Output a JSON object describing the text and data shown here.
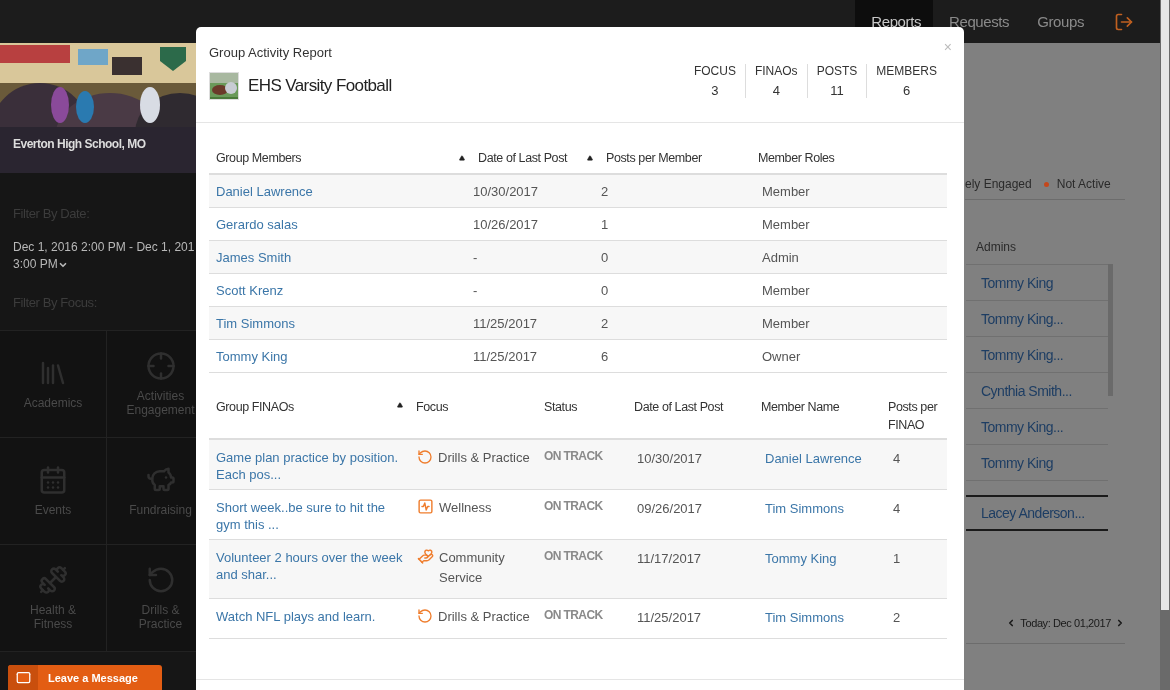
{
  "nav": {
    "items": [
      {
        "label": "Reports",
        "selected": true
      },
      {
        "label": "Requests",
        "selected": false
      },
      {
        "label": "Groups",
        "selected": false
      }
    ]
  },
  "sidebar": {
    "school": "Everton High School, MO",
    "date_filter_label": "Filter By Date:",
    "date_range": [
      "Dec 1, 2016 2:00 PM - Dec 1, 201",
      "3:00 PM"
    ],
    "focus_filter_label": "Filter By Focus:",
    "focus_tiles": [
      {
        "label": "Academics"
      },
      {
        "label": "Activities Engagement"
      },
      {
        "label": "Events"
      },
      {
        "label": "Fundraising"
      },
      {
        "label": "Health & Fitness"
      },
      {
        "label": "Drills & Practice"
      }
    ],
    "leave_message": "Leave a Message"
  },
  "main": {
    "legend": [
      {
        "label": "ely Engaged"
      },
      {
        "label": "Not Active",
        "color": "#c4471c"
      }
    ],
    "admins_header": "Admins",
    "admins": [
      "Tommy King",
      "Tommy King...",
      "Tommy King...",
      "Cynthia Smith...",
      "Tommy King...",
      "Tommy King"
    ],
    "highlighted_admin": "Lacey Anderson...",
    "date_nav": "Today: Dec 01,2017"
  },
  "modal": {
    "title": "Group Activity Report",
    "close": "×",
    "group_name": "EHS Varsity Football",
    "stats": [
      {
        "label": "FOCUS",
        "value": "3"
      },
      {
        "label": "FINAOs",
        "value": "4"
      },
      {
        "label": "POSTS",
        "value": "11"
      },
      {
        "label": "MEMBERS",
        "value": "6"
      }
    ],
    "members_table": {
      "columns": [
        {
          "label": "Group Members",
          "sort_arrow": true
        },
        {
          "label": "Date of Last Post",
          "sort_arrow": true
        },
        {
          "label": "Posts per Member",
          "sort_arrow": false
        },
        {
          "label": "Member Roles",
          "sort_arrow": false
        }
      ],
      "rows": [
        [
          "Daniel Lawrence",
          "10/30/2017",
          "2",
          "Member"
        ],
        [
          "Gerardo salas",
          "10/26/2017",
          "1",
          "Member"
        ],
        [
          "James Smith",
          "-",
          "0",
          "Admin"
        ],
        [
          "Scott Krenz",
          "-",
          "0",
          "Member"
        ],
        [
          "Tim Simmons",
          "11/25/2017",
          "2",
          "Member"
        ],
        [
          "Tommy King",
          "11/25/2017",
          "6",
          "Owner"
        ]
      ]
    },
    "finaos_table": {
      "columns": [
        {
          "label": "Group FINAOs",
          "sort_arrow": true
        },
        {
          "label": "Focus",
          "sort_arrow": false
        },
        {
          "label": "Status",
          "sort_arrow": false
        },
        {
          "label": "Date of Last Post",
          "sort_arrow": false
        },
        {
          "label": "Member Name",
          "sort_arrow": false
        },
        {
          "label": "Posts per FINAO",
          "sort_arrow": false
        }
      ],
      "rows": [
        {
          "finao": "Game plan practice by position. Each pos...",
          "focus": "Drills & Practice",
          "kind": "drills",
          "status": "ON TRACK",
          "date": "10/30/2017",
          "member": "Daniel Lawrence",
          "posts": "4"
        },
        {
          "finao": "Short week..be sure to hit the gym this ...",
          "focus": "Wellness",
          "kind": "wellness",
          "status": "ON TRACK",
          "date": "09/26/2017",
          "member": "Tim Simmons",
          "posts": "4"
        },
        {
          "finao": "Volunteer 2 hours over the week and shar...",
          "focus": "Community Service",
          "kind": "community",
          "status": "ON TRACK",
          "date": "11/17/2017",
          "member": "Tommy King",
          "posts": "1"
        },
        {
          "finao": "Watch NFL plays and learn.",
          "focus": "Drills & Practice",
          "kind": "drills",
          "status": "ON TRACK",
          "date": "11/25/2017",
          "member": "Tim Simmons",
          "posts": "2"
        }
      ]
    }
  }
}
